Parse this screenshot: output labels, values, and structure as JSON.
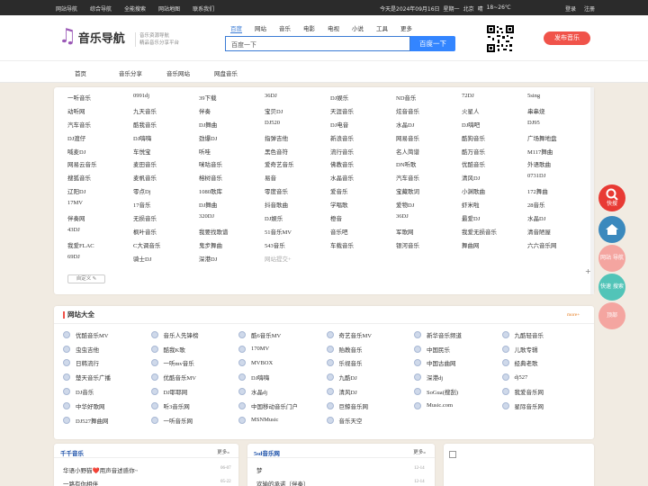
{
  "topbar": {
    "links": [
      "网站导航",
      "综合导航",
      "全能搜索",
      "网站地图",
      "联系我们"
    ],
    "date": "今天是2024年09月16日",
    "weekday": "星期一",
    "city": "北京",
    "weather": "晴",
    "temp": "18~26℃",
    "login": "登录",
    "register": "注册"
  },
  "header": {
    "logo_text": "音乐导航",
    "slogan_line1": "音乐资源导航",
    "slogan_line2": "精品音乐分享平台",
    "search_tabs": [
      "百度",
      "网站",
      "音乐",
      "电影",
      "电视",
      "小说",
      "工具",
      "更多"
    ],
    "search_placeholder": "百度一下",
    "search_button": "百度一下",
    "publish_button": "发布音乐"
  },
  "nav": {
    "items": [
      "首页",
      "音乐分享",
      "音乐网站",
      "网盘音乐"
    ]
  },
  "sites": [
    "一听音乐",
    "0991dj",
    "39下载",
    "36DJ",
    "DJ娱乐",
    "ND音乐",
    "72DJ",
    "5sing",
    "动听网",
    "九天音乐",
    "伴奏",
    "宝贝DJ",
    "天涯音乐",
    "炫音音乐",
    "火星人",
    "串串烧",
    "汽车音乐",
    "酷我音乐",
    "DJ舞曲",
    "DJ520",
    "DJ电音",
    "水晶DJ",
    "DJ嗨吧",
    "DJ95",
    "DJ渡仔",
    "DJ嗨嗨",
    "劲爆DJ",
    "指弹吉他",
    "新浪音乐",
    "网易音乐",
    "酷狗音乐",
    "广场舞地盘",
    "喊麦DJ",
    "车悦宝",
    "听哇",
    "黑色音符",
    "流行音乐",
    "名人简谱",
    "酷万音乐",
    "M117舞曲",
    "网易云音乐",
    "麦田音乐",
    "咪咕音乐",
    "爱奇艺音乐",
    "佛教音乐",
    "DN听歌",
    "优酷音乐",
    "外语歌曲",
    "搜狐音乐",
    "麦帆音乐",
    "榕树音乐",
    "易音",
    "水晶音乐",
    "汽车音乐",
    "清风DJ",
    "0731DJ",
    "辽阳DJ",
    "零点Dj",
    "1080歌库",
    "零度音乐",
    "爱音乐",
    "宝藏歌词",
    "小渊歌曲",
    "172舞曲",
    "17MV",
    "17音乐",
    "DJ舞曲",
    "抖音歌曲",
    "学唱歌",
    "爱物DJ",
    "虾米啦",
    "28音乐",
    "伴奏网",
    "无损音乐",
    "320DJ",
    "DJ娱乐",
    "橙音",
    "36DJ",
    "最爱DJ",
    "水晶DJ",
    "43DJ",
    "枫叶音乐",
    "我要找歌谱",
    "51音乐MV",
    "音乐吧",
    "军歌网",
    "我爱无损音乐",
    "清音陋屋",
    "我爱FLAC",
    "C大调音乐",
    "鬼步舞曲",
    "543音乐",
    "车载音乐",
    "银河音乐",
    "舞曲网",
    "六六音乐网",
    "69DJ",
    "骑士DJ",
    "深港DJ",
    "网站提交+"
  ],
  "custom_button": "自定义 ✎",
  "directory": {
    "title": "网站大全",
    "more": "more+",
    "items": [
      "优酷音乐MV",
      "音乐人先锋榜",
      "酷6音乐MV",
      "奇艺音乐MV",
      "新华音乐频道",
      "九酷轻音乐",
      "虫虫吉他",
      "酷我K歌",
      "170MV",
      "贻教音乐",
      "中国民乐",
      "儿歌专辑",
      "日韩流行",
      "一听mv音乐",
      "MVBOX",
      "乐视音乐",
      "中国古曲网",
      "经典老歌",
      "楚天音乐广播",
      "优酷音乐MV",
      "DJ嗨嗨",
      "九酷DJ",
      "深港dj",
      "dj527",
      "DJ音乐",
      "DJ耶耶网",
      "水晶dj",
      "清风DJ",
      "SoGua(搜刮)",
      "我爱音乐网",
      "中华好歌网",
      "听3音乐网",
      "中国移动音乐门户",
      "巨鲸音乐网",
      "Music.com",
      "星际音乐网",
      "DJ527舞曲网",
      "一听音乐网",
      "MSNMusic",
      "音乐天空"
    ]
  },
  "bottom": {
    "p1": {
      "title": "千千音乐",
      "more": "更多»",
      "rows": [
        {
          "text": "华语小野猫❤️用声音述惑你~",
          "date": "06-07"
        },
        {
          "text": "一路有你相伴",
          "date": "05-22"
        }
      ]
    },
    "p2": {
      "title": "5sd音乐网",
      "more": "更多»",
      "rows": [
        {
          "text": "梦",
          "date": "12-14"
        },
        {
          "text": "欢输的承诺（伴奏）",
          "date": "12-14"
        }
      ]
    }
  },
  "floats": [
    {
      "label": "快搜",
      "color": "#e83a34"
    },
    {
      "label": "",
      "color": "#3b89bd"
    },
    {
      "label": "网站 导航",
      "color": "#f4a5a0"
    },
    {
      "label": "快速 搜索",
      "color": "#52c4b8"
    },
    {
      "label": "顶部",
      "color": "#f4a5a0"
    }
  ]
}
